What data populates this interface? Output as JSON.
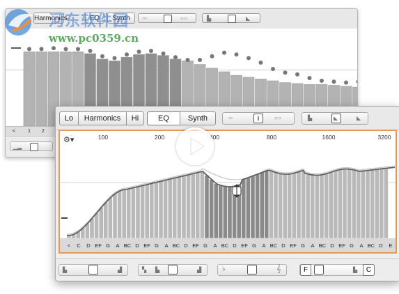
{
  "back_window": {
    "tabs": [
      "Harmonics",
      "EQ",
      "Synth"
    ],
    "keys": [
      "<",
      "1",
      "2"
    ],
    "bars": [
      0.82,
      0.82,
      0.82,
      0.82,
      0.82,
      0.8,
      0.74,
      0.72,
      0.76,
      0.79,
      0.8,
      0.78,
      0.74,
      0.72,
      0.68,
      0.64,
      0.6,
      0.56,
      0.54,
      0.52,
      0.5,
      0.48,
      0.47,
      0.46,
      0.46,
      0.45,
      0.44,
      0.43
    ],
    "dots": [
      0.82,
      0.82,
      0.83,
      0.82,
      0.82,
      0.8,
      0.74,
      0.72,
      0.76,
      0.79,
      0.8,
      0.77,
      0.73,
      0.7,
      0.7,
      0.74,
      0.78,
      0.76,
      0.72,
      0.67,
      0.6,
      0.56,
      0.54,
      0.5,
      0.47,
      0.46,
      0.45,
      0.46
    ]
  },
  "front_window": {
    "tabs": [
      "Lo",
      "Harmonics",
      "Hi",
      "EQ",
      "Synth"
    ],
    "active_tab": "EQ",
    "freq_labels": [
      "100",
      "200",
      "400",
      "800",
      "1600",
      "3200"
    ],
    "note_labels": [
      "<",
      "C",
      "D",
      "EF",
      "G",
      "A",
      "BC",
      "D",
      "EF",
      "G",
      "A",
      "BC",
      "D",
      "EF",
      "G",
      "A",
      "BC",
      "D",
      "EF",
      "G",
      "A",
      "BC",
      "D",
      "EF",
      "G",
      "A",
      "BC",
      "D",
      "EF",
      "G",
      "A",
      "BC",
      "D",
      "E"
    ],
    "bottom_right": {
      "left_key": "F",
      "right_key": "C"
    }
  },
  "watermark": {
    "text": "河东软件园",
    "url": "www.pc0359.cn"
  }
}
